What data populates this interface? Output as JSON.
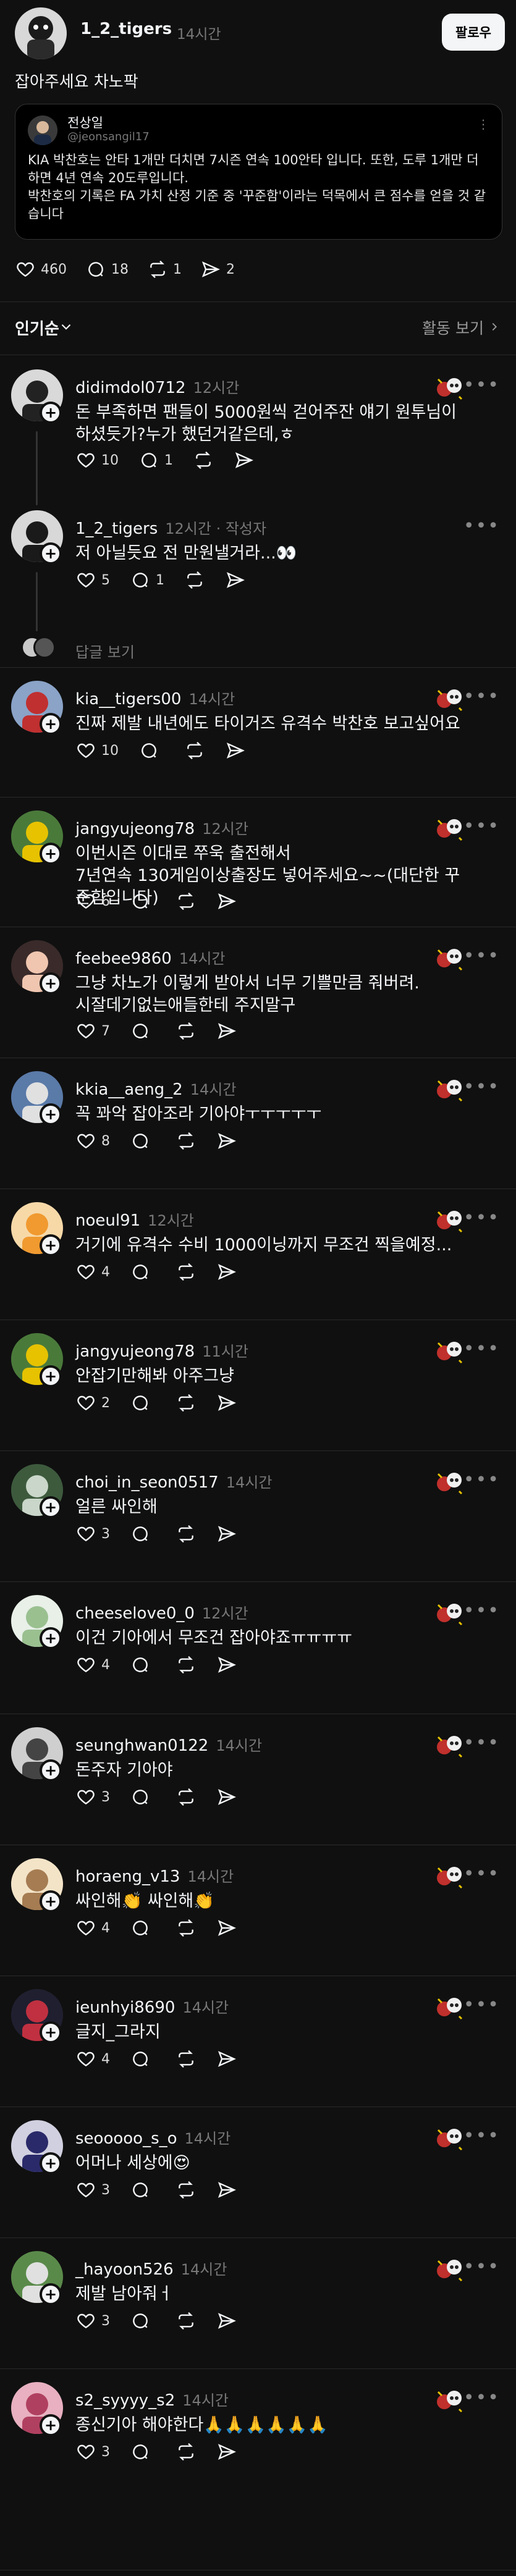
{
  "post": {
    "username": "1_2_tigers",
    "time": "14시간",
    "follow_label": "팔로우",
    "text": "잡아주세요 차노팍",
    "quote": {
      "name": "전상일",
      "handle": "@jeonsangil17",
      "body": "KIA 박찬호는 안타 1개만 더치면 7시즌 연속 100안타 입니다. 또한, 도루 1개만 더 하면 4년 연속 20도루입니다.\n박찬호의 기록은 FA 가치 산정 기준 중 '꾸준함'이라는 덕목에서 큰 점수를 얻을 것 같습니다"
    },
    "likes": "460",
    "comments": "18",
    "reposts": "1",
    "shares": "2"
  },
  "sort": {
    "label": "인기순",
    "activity": "활동 보기"
  },
  "replies": [
    {
      "user": "didimdol0712",
      "time": "12시간",
      "text": "돈 부족하면 팬들이 5000원씩 걷어주잔 얘기 원투님이 하셨듯가?누가 했던거같은데,ㅎ",
      "likes": "10",
      "comments": "1"
    },
    {
      "user": "1_2_tigers",
      "time": "12시간 · 작성자",
      "text": "저 아닐듯요 전 만원낼거라...👀",
      "likes": "5",
      "comments": "1"
    },
    {
      "user": "kia__tigers00",
      "time": "14시간",
      "text": "진짜 제발 내년에도 타이거즈 유격수 박찬호 보고싶어요",
      "likes": "10",
      "comments": ""
    },
    {
      "user": "jangyujeong78",
      "time": "12시간",
      "text": "이번시즌 이대로 쭈욱 출전해서\n7년연속 130게임이상출장도 넣어주세요~~(대단한 꾸준함입니다)",
      "likes": "6",
      "comments": ""
    },
    {
      "user": "feebee9860",
      "time": "14시간",
      "text": "그냥 차노가 이렇게 받아서 너무 기쁠만큼 줘버려.\n시잘데기없는애들한테 주지말구",
      "likes": "7",
      "comments": ""
    },
    {
      "user": "kkia__aeng_2",
      "time": "14시간",
      "text": "꼭 꽈악 잡아조라 기아야ㅜㅜㅜㅜㅜ",
      "likes": "8",
      "comments": ""
    },
    {
      "user": "noeul91",
      "time": "12시간",
      "text": "거기에 유격수 수비 1000이닝까지 무조건 찍을예정...",
      "likes": "4",
      "comments": ""
    },
    {
      "user": "jangyujeong78",
      "time": "11시간",
      "text": "안잡기만해봐 아주그냥",
      "likes": "2",
      "comments": ""
    },
    {
      "user": "choi_in_seon0517",
      "time": "14시간",
      "text": "얼른 싸인해",
      "likes": "3",
      "comments": ""
    },
    {
      "user": "cheeselove0_0",
      "time": "12시간",
      "text": "이건 기아에서 무조건 잡아야죠ㅠㅠㅠㅠ",
      "likes": "4",
      "comments": ""
    },
    {
      "user": "seunghwan0122",
      "time": "14시간",
      "text": "돈주자 기아야",
      "likes": "3",
      "comments": ""
    },
    {
      "user": "horaeng_v13",
      "time": "14시간",
      "text": "싸인해👏 싸인해👏",
      "likes": "4",
      "comments": ""
    },
    {
      "user": "ieunhyi8690",
      "time": "14시간",
      "text": "글지_그라지",
      "likes": "4",
      "comments": ""
    },
    {
      "user": "seooooo_s_o",
      "time": "14시간",
      "text": "어머나 세상에😍",
      "likes": "3",
      "comments": ""
    },
    {
      "user": "_hayoon526",
      "time": "14시간",
      "text": "제발 남아줘ㅓ",
      "likes": "3",
      "comments": ""
    },
    {
      "user": "s2_syyyy_s2",
      "time": "14시간",
      "text": "종신기아 해야한다🙏🙏🙏🙏🙏🙏",
      "likes": "3",
      "comments": ""
    }
  ],
  "view_replies": "답글 보기",
  "colors": {
    "bg": "#101010",
    "text": "#f3f5f7",
    "muted": "#777777",
    "divider": "#2a2a2a"
  },
  "icons": [
    "heart-icon",
    "comment-icon",
    "repost-icon",
    "share-icon",
    "more-icon",
    "chevron-down-icon",
    "chevron-right-icon",
    "plus-icon"
  ]
}
